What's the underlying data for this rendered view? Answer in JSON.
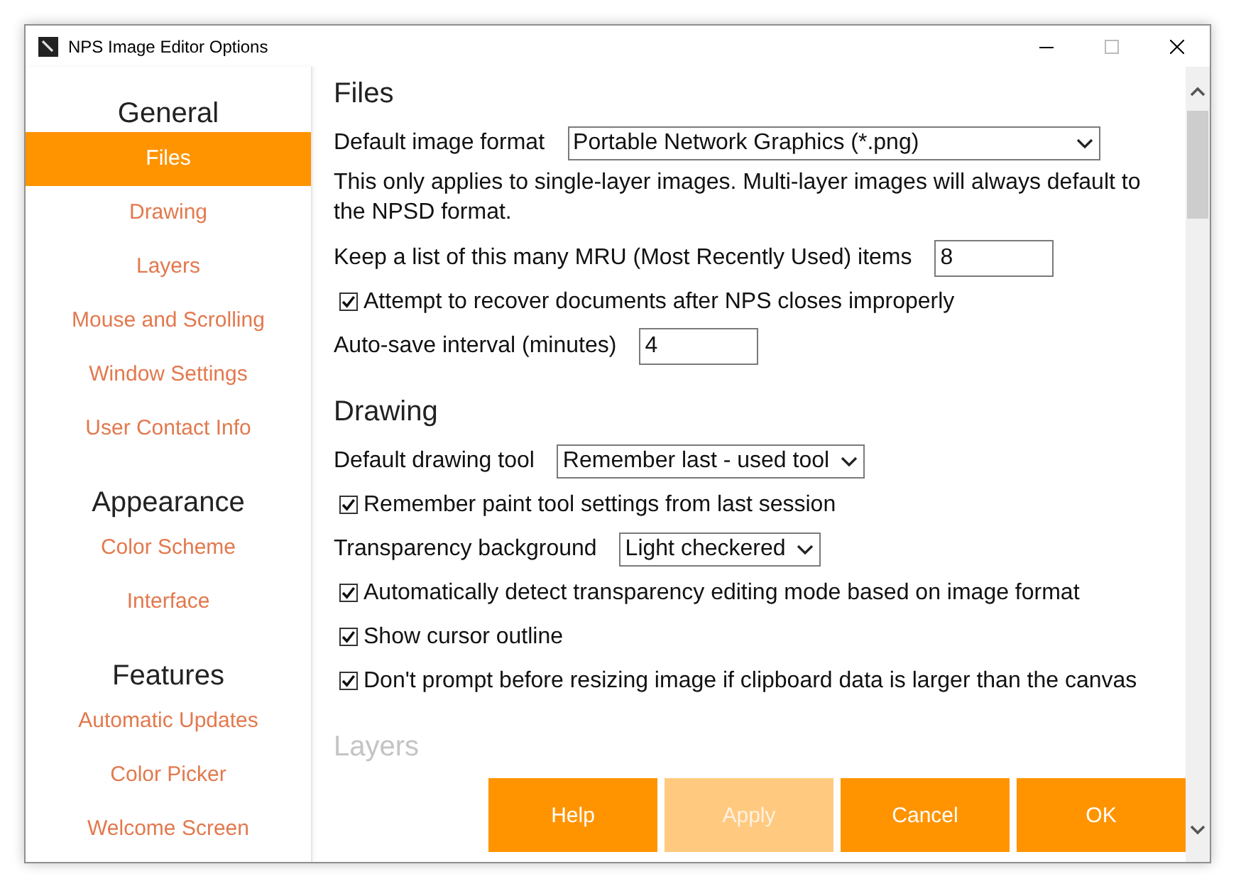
{
  "window": {
    "title": "NPS Image Editor Options"
  },
  "sidebar": {
    "groups": [
      {
        "heading": "General",
        "items": [
          {
            "label": "Files",
            "selected": true
          },
          {
            "label": "Drawing",
            "selected": false
          },
          {
            "label": "Layers",
            "selected": false
          },
          {
            "label": "Mouse and Scrolling",
            "selected": false
          },
          {
            "label": "Window Settings",
            "selected": false
          },
          {
            "label": "User Contact Info",
            "selected": false
          }
        ]
      },
      {
        "heading": "Appearance",
        "items": [
          {
            "label": "Color Scheme",
            "selected": false
          },
          {
            "label": "Interface",
            "selected": false
          }
        ]
      },
      {
        "heading": "Features",
        "items": [
          {
            "label": "Automatic Updates",
            "selected": false
          },
          {
            "label": "Color Picker",
            "selected": false
          },
          {
            "label": "Welcome Screen",
            "selected": false
          }
        ]
      }
    ]
  },
  "sections": [
    {
      "heading": "Files",
      "faded": false,
      "rows": [
        {
          "kind": "dropdown",
          "label": "Default image format",
          "value": "Portable Network Graphics (*.png)"
        },
        {
          "kind": "note",
          "text": "This only applies to single-layer images. Multi-layer images will always default to the NPSD format."
        },
        {
          "kind": "number",
          "label": "Keep a list of this many MRU (Most Recently Used) items",
          "value": "8"
        },
        {
          "kind": "checkbox",
          "label": "Attempt to recover documents after NPS closes improperly",
          "checked": true
        },
        {
          "kind": "number",
          "label": "Auto-save interval (minutes)",
          "value": "4"
        }
      ]
    },
    {
      "heading": "Drawing",
      "faded": false,
      "rows": [
        {
          "kind": "dropdown",
          "label": "Default drawing tool",
          "value": "Remember last - used tool"
        },
        {
          "kind": "checkbox",
          "label": "Remember paint tool settings from last session",
          "checked": true
        },
        {
          "kind": "dropdown",
          "label": "Transparency background",
          "value": "Light checkered"
        },
        {
          "kind": "checkbox",
          "label": "Automatically detect transparency editing mode based on image format",
          "checked": true
        },
        {
          "kind": "checkbox",
          "label": "Show cursor outline",
          "checked": true
        },
        {
          "kind": "checkbox",
          "label": "Don't prompt before resizing image if clipboard data is larger than the canvas",
          "checked": true
        }
      ]
    },
    {
      "heading": "Layers",
      "faded": true
    }
  ],
  "buttons": [
    {
      "label": "Help",
      "disabled": false
    },
    {
      "label": "Apply",
      "disabled": true
    },
    {
      "label": "Cancel",
      "disabled": false
    },
    {
      "label": "OK",
      "disabled": false
    }
  ]
}
